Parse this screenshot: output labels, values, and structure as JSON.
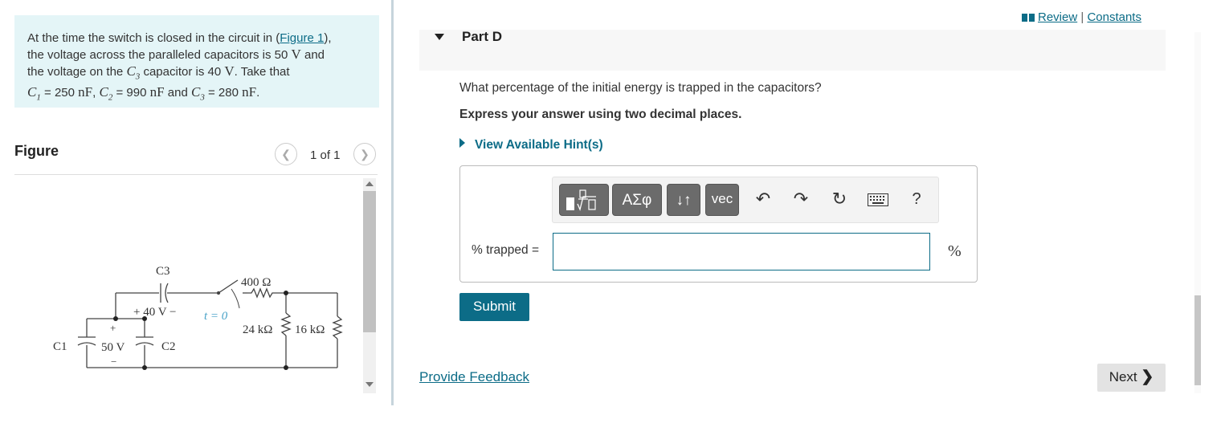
{
  "problem": {
    "t1": "At the time the switch is closed in the circuit in (",
    "figure_link": "Figure 1",
    "t2": "),",
    "t3": "the voltage across the paralleled capacitors is 50",
    "v_unit": "V",
    "t4": "and",
    "t5": "the voltage on the",
    "c3": "C",
    "c3_sub": "3",
    "t6": "capacitor is 40",
    "t7": ". Take that",
    "c1": "C",
    "c1_sub": "1",
    "c1_val": "= 250",
    "nf": "nF",
    "c2": "C",
    "c2_sub": "2",
    "c2_val": "= 990",
    "and": "and",
    "c3_val": "= 280",
    "end": "."
  },
  "figure": {
    "title": "Figure",
    "counter": "1 of 1",
    "prev_icon": "chevron-left-icon",
    "next_icon": "chevron-right-icon",
    "labels": {
      "c3": "C3",
      "v40": "+ 40 V −",
      "t0": "t = 0",
      "r400": "400 Ω",
      "r24": "24 kΩ",
      "r16": "16 kΩ",
      "c1": "C1",
      "v50": "50 V",
      "c2": "C2",
      "plus": "+",
      "minus": "−"
    }
  },
  "header": {
    "review": "Review",
    "sep": "|",
    "constants": "Constants",
    "part_title": "Part D"
  },
  "question": {
    "text": "What percentage of the initial energy is trapped in the capacitors?",
    "instruction": "Express your answer using two decimal places.",
    "hint": "View Available Hint(s)"
  },
  "toolbar": {
    "templates_icon": "fraction-sqrt-template-icon",
    "greek": "ΑΣφ",
    "arrows": "↓↑",
    "vec": "vec",
    "undo_icon": "undo-icon",
    "redo_icon": "redo-icon",
    "reset_icon": "reset-icon",
    "keyboard_icon": "keyboard-icon",
    "help": "?"
  },
  "answer": {
    "label": "% trapped =",
    "value": "",
    "unit": "%"
  },
  "buttons": {
    "submit": "Submit",
    "feedback": "Provide Feedback",
    "next": "Next"
  },
  "colors": {
    "accent": "#0c6c87",
    "problem_bg": "#e4f5f7"
  }
}
